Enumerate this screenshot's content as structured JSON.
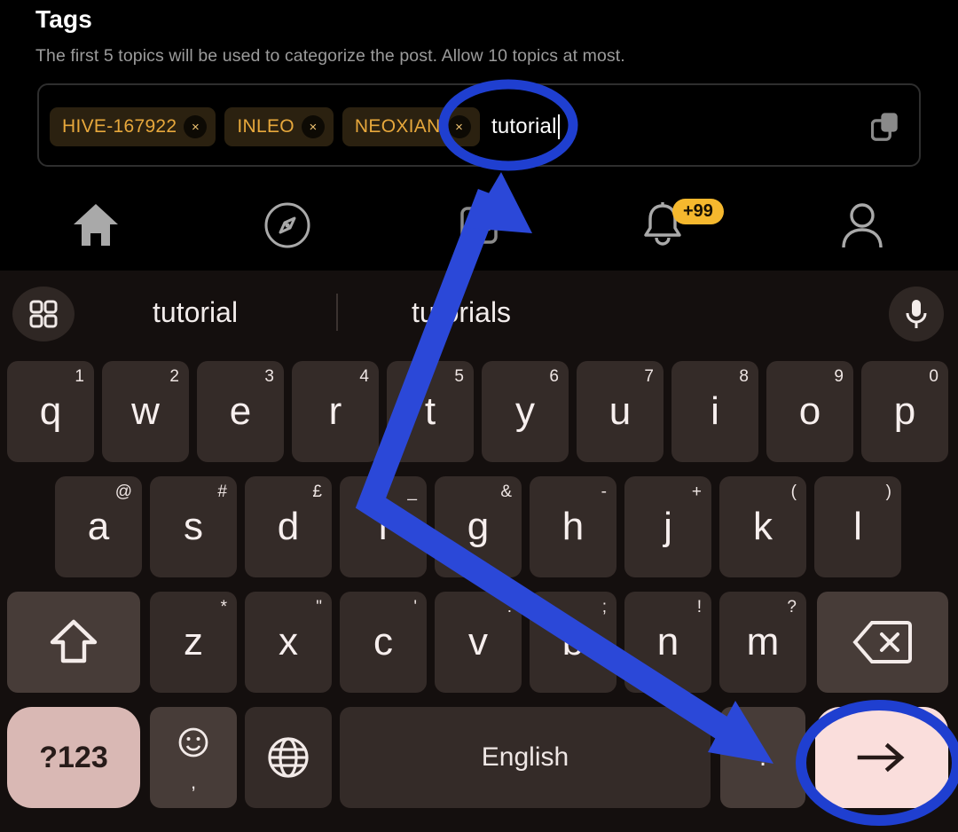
{
  "form": {
    "title": "Tags",
    "help": "The first 5 topics will be used to categorize the post. Allow 10 topics at most.",
    "chips": [
      {
        "label": "HIVE-167922",
        "remove": "×"
      },
      {
        "label": "INLEO",
        "remove": "×"
      },
      {
        "label": "NEOXIAN",
        "remove": "×"
      }
    ],
    "input_value": "tutorial",
    "copy_icon": "copy-icon"
  },
  "navbar": {
    "items": [
      {
        "icon": "home-icon"
      },
      {
        "icon": "compass-icon"
      },
      {
        "icon": "wallet-icon"
      },
      {
        "icon": "bell-icon",
        "badge": "+99"
      },
      {
        "icon": "profile-icon"
      }
    ],
    "badge_color": "#f5b82e"
  },
  "keyboard": {
    "suggestions": {
      "grid_icon": "grid-icon",
      "words": [
        "tutorial",
        "tutorials"
      ],
      "mic_icon": "microphone-icon"
    },
    "row1": [
      {
        "main": "q",
        "alt": "1"
      },
      {
        "main": "w",
        "alt": "2"
      },
      {
        "main": "e",
        "alt": "3"
      },
      {
        "main": "r",
        "alt": "4"
      },
      {
        "main": "t",
        "alt": "5"
      },
      {
        "main": "y",
        "alt": "6"
      },
      {
        "main": "u",
        "alt": "7"
      },
      {
        "main": "i",
        "alt": "8"
      },
      {
        "main": "o",
        "alt": "9"
      },
      {
        "main": "p",
        "alt": "0"
      }
    ],
    "row2": [
      {
        "main": "a",
        "alt": "@"
      },
      {
        "main": "s",
        "alt": "#"
      },
      {
        "main": "d",
        "alt": "£"
      },
      {
        "main": "f",
        "alt": "_"
      },
      {
        "main": "g",
        "alt": "&"
      },
      {
        "main": "h",
        "alt": "-"
      },
      {
        "main": "j",
        "alt": "+"
      },
      {
        "main": "k",
        "alt": "("
      },
      {
        "main": "l",
        "alt": ")"
      }
    ],
    "row3": [
      {
        "main": "z",
        "alt": "*"
      },
      {
        "main": "x",
        "alt": "\""
      },
      {
        "main": "c",
        "alt": "'"
      },
      {
        "main": "v",
        "alt": ":"
      },
      {
        "main": "b",
        "alt": ";"
      },
      {
        "main": "n",
        "alt": "!"
      },
      {
        "main": "m",
        "alt": "?"
      }
    ],
    "shift_icon": "shift-icon",
    "backspace_icon": "backspace-icon",
    "row4": {
      "symbols_label": "?123",
      "emoji_icon": "emoji-icon",
      "comma": ",",
      "globe_icon": "globe-icon",
      "space_label": "English",
      "period": ".",
      "enter_icon": "enter-arrow-icon"
    }
  },
  "annotation": {
    "color": "#1f3fd0",
    "highlight_input": "tutorial",
    "highlight_key": "enter-arrow-icon"
  }
}
